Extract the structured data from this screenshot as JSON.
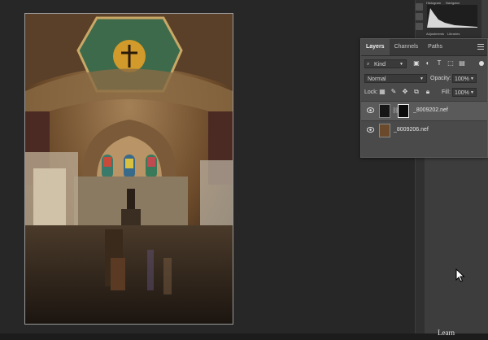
{
  "mini_panel": {
    "tabs": [
      "Histogram",
      "Navigator"
    ],
    "tabs2": [
      "Adjustments",
      "Libraries"
    ]
  },
  "layers_panel": {
    "tabs": [
      {
        "label": "Layers",
        "active": true
      },
      {
        "label": "Channels",
        "active": false
      },
      {
        "label": "Paths",
        "active": false
      }
    ],
    "filter": {
      "kind": "Kind",
      "icons": [
        "image-filter-icon",
        "adjustment-filter-icon",
        "type-filter-icon",
        "shape-filter-icon",
        "smart-object-filter-icon"
      ]
    },
    "blend_mode": "Normal",
    "opacity_label": "Opacity:",
    "opacity_value": "100%",
    "lock_label": "Lock:",
    "fill_label": "Fill:",
    "fill_value": "100%",
    "layers": [
      {
        "name": "_8009202.nef",
        "selected": true,
        "has_mask": true
      },
      {
        "name": "_8009206.nef",
        "selected": false,
        "has_mask": false
      }
    ]
  },
  "watermark": "Learn"
}
